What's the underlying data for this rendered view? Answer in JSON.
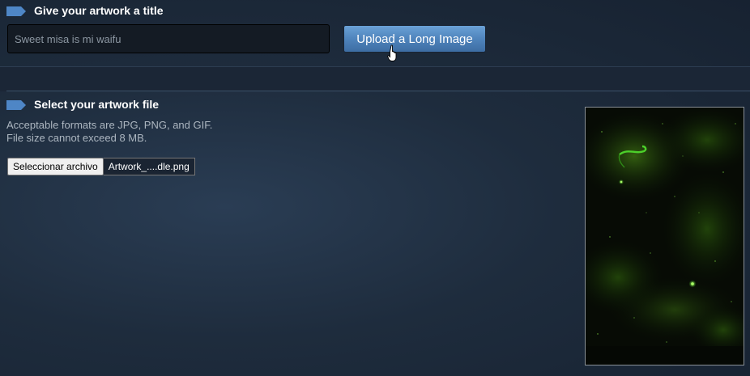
{
  "title_section": {
    "heading": "Give your artwork a title",
    "input_value": "Sweet misa is mi waifu",
    "upload_button_label": "Upload a Long Image"
  },
  "file_section": {
    "heading": "Select your artwork file",
    "help_line1": "Acceptable formats are JPG, PNG, and GIF.",
    "help_line2": "File size cannot exceed 8 MB.",
    "file_button_label": "Seleccionar archivo",
    "file_name": "Artwork_....dle.png"
  },
  "colors": {
    "tag_icon": "#4e86c6",
    "button_blue": "#5a8fc8",
    "preview_green": "#4cd12a"
  }
}
